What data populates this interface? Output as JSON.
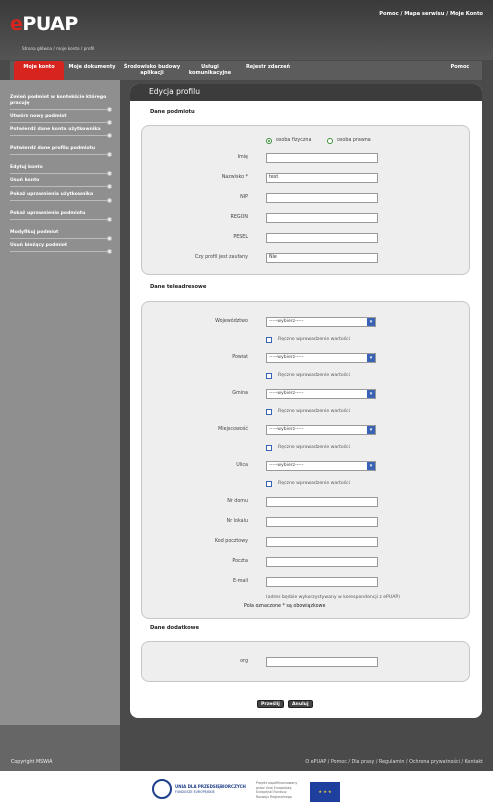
{
  "header": {
    "logo_prefix": "e",
    "logo_rest": "PUAP",
    "links": [
      "Pomoc",
      "Mapa serwisu",
      "Moje Konto"
    ],
    "link_separator": "/",
    "breadcrumb": "Strona główna / moje konto / profil"
  },
  "nav": {
    "items": [
      {
        "label": "Moje konto",
        "active": true
      },
      {
        "label": "Moje dokumenty"
      },
      {
        "label": "Środowisko budowy aplikacji"
      },
      {
        "label": "Usługi komunikacyjne"
      },
      {
        "label": "Rejestr zdarzeń"
      },
      {
        "label": "Pomoc"
      }
    ]
  },
  "sidebar": {
    "items": [
      "Zmień podmiot w kontekście którego pracuję",
      "Utwórz nowy podmiot",
      "Potwierdź dane konta użytkownika",
      "Potwierdź dane profilu podmiotu",
      "Edytuj konto",
      "Usuń konto",
      "Pokaż uprawnienia użytkownika",
      "Pokaż uprawnienia podmiotu",
      "Modyfikuj podmiot",
      "Usuń bieżący podmiot"
    ]
  },
  "page_title": "Edycja profilu",
  "sections": {
    "podmiot": {
      "title": "Dane podmiotu",
      "radio_fizyczna": "osoba fizyczna",
      "radio_prawna": "osoba prawna",
      "fields": [
        {
          "label": "Imię",
          "value": ""
        },
        {
          "label": "Nazwisko *",
          "value": "test"
        },
        {
          "label": "NIP",
          "value": ""
        },
        {
          "label": "REGON",
          "value": ""
        },
        {
          "label": "PESEL",
          "value": ""
        },
        {
          "label": "Czy profil jest zaufany",
          "value": "Nie"
        }
      ]
    },
    "teleadresowe": {
      "title": "Dane teleadresowe",
      "select_placeholder": "-----wybierz-----",
      "manual_label": "Ręczne wprowadzenie wartości",
      "selects": [
        "Województwo",
        "Powiat",
        "Gmina",
        "Miejscowość",
        "Ulica"
      ],
      "fields": [
        {
          "label": "Nr domu",
          "value": ""
        },
        {
          "label": "Nr lokalu",
          "value": ""
        },
        {
          "label": "Kod pocztowy",
          "value": ""
        },
        {
          "label": "Poczta",
          "value": ""
        },
        {
          "label": "E-mail",
          "value": ""
        }
      ],
      "email_note": "(adres będzie wykorzystywany w korespondencji z ePUAP)",
      "required_note": "Pola oznaczone * są obowiązkowe"
    },
    "dodatkowe": {
      "title": "Dane dodatkowe",
      "fields": [
        {
          "label": "org",
          "value": ""
        }
      ]
    }
  },
  "buttons": {
    "submit": "Prześlij",
    "cancel": "Anuluj"
  },
  "footer": {
    "copyright": "Copyright MSWiA",
    "links": [
      "O ePUAP",
      "Pomoc",
      "Dla prasy",
      "Regulamin",
      "Ochrona prywatności",
      "Kontakt"
    ],
    "logo_text_1": "UNIA DLA PRZEDSIĘBIORCZYCH",
    "logo_text_2": "FUNDUSZE EUROPEJSKIE",
    "eu_text_1": "Projekt współfinansowany",
    "eu_text_2": "przez Unię Europejską",
    "eu_text_3": "Europejski Fundusz",
    "eu_text_4": "Rozwoju Regionalnego"
  },
  "colors": {
    "brand_red": "#d8241e",
    "dark": "#3c3c3c",
    "sidebar": "#8f8f8f",
    "accent_blue": "#3b63b5"
  }
}
